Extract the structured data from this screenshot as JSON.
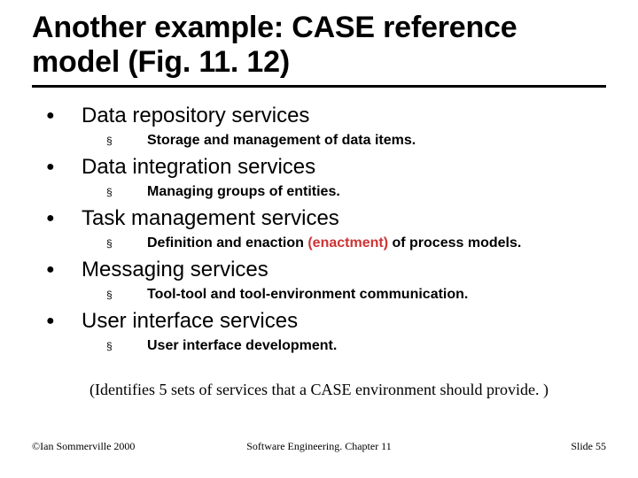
{
  "title": "Another example: CASE reference model (Fig. 11. 12)",
  "items": [
    {
      "label": "Data repository services",
      "sub_prefix": "Storage and management of data items.",
      "sub_accent": "",
      "sub_suffix": ""
    },
    {
      "label": "Data integration services",
      "sub_prefix": "Managing groups of entities.",
      "sub_accent": "",
      "sub_suffix": ""
    },
    {
      "label": "Task management services",
      "sub_prefix": "Definition and enaction ",
      "sub_accent": "(enactment)",
      "sub_suffix": " of process models."
    },
    {
      "label": "Messaging services",
      "sub_prefix": "Tool-tool and tool-environment communication.",
      "sub_accent": "",
      "sub_suffix": ""
    },
    {
      "label": "User interface services",
      "sub_prefix": "User interface development.",
      "sub_accent": "",
      "sub_suffix": ""
    }
  ],
  "note": "(Identifies 5 sets of services that a CASE environment should provide. )",
  "footer": {
    "left": "©Ian Sommerville 2000",
    "center": "Software Engineering. Chapter 11",
    "right": "Slide 55"
  },
  "bullets": {
    "lvl1": "●",
    "lvl2": "§"
  }
}
